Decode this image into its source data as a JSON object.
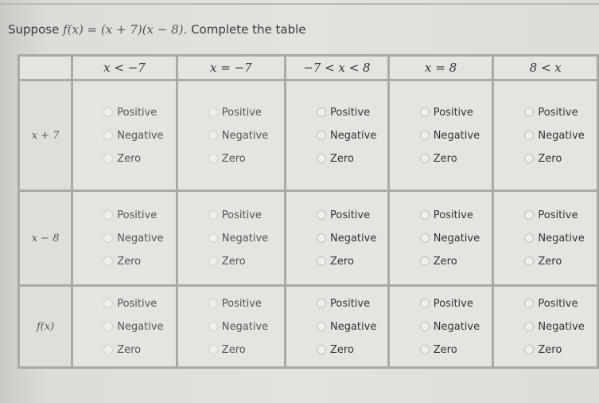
{
  "question": {
    "prefix": "Suppose",
    "function_expr": "f(x) = (x + 7)(x − 8).",
    "instruction": "Complete the table"
  },
  "table": {
    "corner": "",
    "columns": [
      "x < −7",
      "x = −7",
      "−7 < x < 8",
      "x = 8",
      "8 < x"
    ],
    "rows": [
      {
        "label": "x + 7",
        "cells": [
          {
            "options": [
              "Positive",
              "Negative",
              "Zero"
            ],
            "selected": null
          },
          {
            "options": [
              "Positive",
              "Negative",
              "Zero"
            ],
            "selected": null
          },
          {
            "options": [
              "Positive",
              "Negative",
              "Zero"
            ],
            "selected": null
          },
          {
            "options": [
              "Positive",
              "Negative",
              "Zero"
            ],
            "selected": null
          },
          {
            "options": [
              "Positive",
              "Negative",
              "Zero"
            ],
            "selected": null
          }
        ]
      },
      {
        "label": "x − 8",
        "cells": [
          {
            "options": [
              "Positive",
              "Negative",
              "Zero"
            ],
            "selected": null
          },
          {
            "options": [
              "Positive",
              "Negative",
              "Zero"
            ],
            "selected": null
          },
          {
            "options": [
              "Positive",
              "Negative",
              "Zero"
            ],
            "selected": null
          },
          {
            "options": [
              "Positive",
              "Negative",
              "Zero"
            ],
            "selected": null
          },
          {
            "options": [
              "Positive",
              "Negative",
              "Zero"
            ],
            "selected": null
          }
        ]
      },
      {
        "label": "f(x)",
        "cells": [
          {
            "options": [
              "Positive",
              "Negative",
              "Zero"
            ],
            "selected": null
          },
          {
            "options": [
              "Positive",
              "Negative",
              "Zero"
            ],
            "selected": null
          },
          {
            "options": [
              "Positive",
              "Negative",
              "Zero"
            ],
            "selected": null
          },
          {
            "options": [
              "Positive",
              "Negative",
              "Zero"
            ],
            "selected": null
          },
          {
            "options": [
              "Positive",
              "Negative",
              "Zero"
            ],
            "selected": null
          }
        ]
      }
    ]
  },
  "icons": {
    "radio": "radio-unchecked-icon"
  }
}
